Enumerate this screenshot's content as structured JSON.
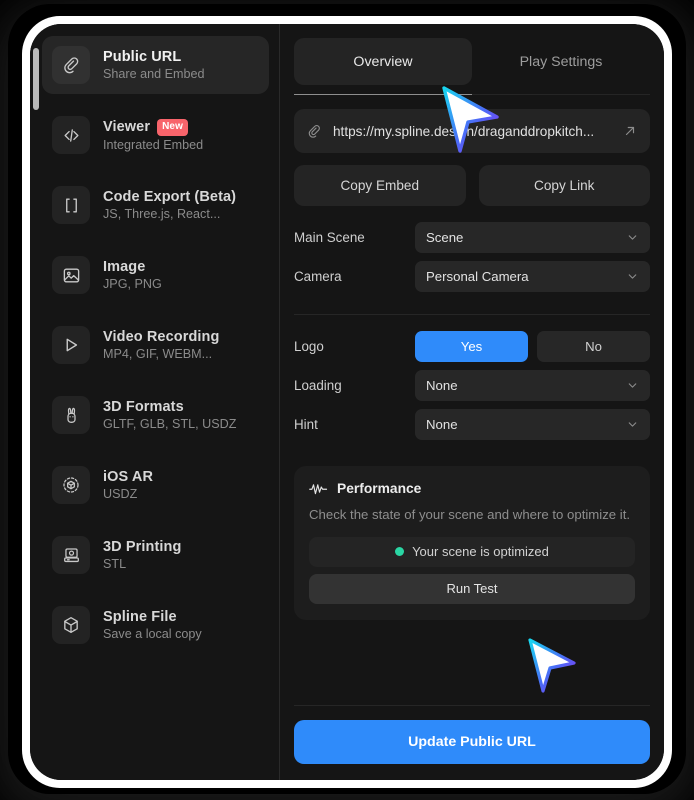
{
  "sidebar": {
    "items": [
      {
        "icon": "link-icon",
        "title": "Public URL",
        "subtitle": "Share and Embed",
        "badge": null,
        "active": true
      },
      {
        "icon": "code-icon",
        "title": "Viewer",
        "subtitle": "Integrated Embed",
        "badge": "New",
        "active": false
      },
      {
        "icon": "brackets-icon",
        "title": "Code Export (Beta)",
        "subtitle": "JS, Three.js, React...",
        "badge": null,
        "active": false
      },
      {
        "icon": "image-icon",
        "title": "Image",
        "subtitle": "JPG, PNG",
        "badge": null,
        "active": false
      },
      {
        "icon": "play-icon",
        "title": "Video Recording",
        "subtitle": "MP4, GIF, WEBM...",
        "badge": null,
        "active": false
      },
      {
        "icon": "rabbit-icon",
        "title": "3D Formats",
        "subtitle": "GLTF, GLB, STL, USDZ",
        "badge": null,
        "active": false
      },
      {
        "icon": "ar-cube-icon",
        "title": "iOS AR",
        "subtitle": "USDZ",
        "badge": null,
        "active": false
      },
      {
        "icon": "printer-3d-icon",
        "title": "3D Printing",
        "subtitle": "STL",
        "badge": null,
        "active": false
      },
      {
        "icon": "cube-icon",
        "title": "Spline File",
        "subtitle": "Save a local copy",
        "badge": null,
        "active": false
      }
    ]
  },
  "main": {
    "tabs": [
      {
        "label": "Overview",
        "active": true
      },
      {
        "label": "Play Settings",
        "active": false
      }
    ],
    "url": {
      "value": "https://my.spline.design/draganddropkitch...",
      "link_icon": "link-icon",
      "open_icon": "external-link-icon"
    },
    "actions": {
      "copy_embed": "Copy Embed",
      "copy_link": "Copy Link"
    },
    "fields": [
      {
        "label": "Main Scene",
        "value": "Scene"
      },
      {
        "label": "Camera",
        "value": "Personal Camera"
      }
    ],
    "logo": {
      "label": "Logo",
      "yes": "Yes",
      "no": "No",
      "selected": "Yes"
    },
    "options": [
      {
        "label": "Loading",
        "value": "None"
      },
      {
        "label": "Hint",
        "value": "None"
      }
    ],
    "performance": {
      "icon": "pulse-icon",
      "title": "Performance",
      "description": "Check the state of your scene and where to optimize it.",
      "status": "Your scene is optimized",
      "status_color": "#2ad6a4",
      "run_test": "Run Test"
    },
    "footer": {
      "primary_button": "Update Public URL",
      "accent_color": "#2f8bfa"
    }
  }
}
